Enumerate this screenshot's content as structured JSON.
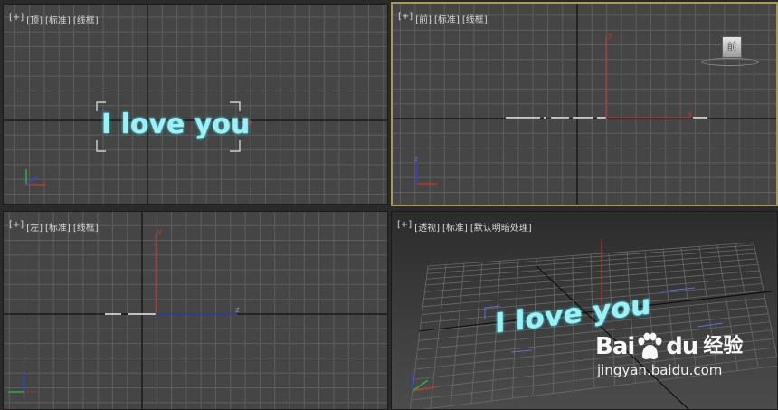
{
  "viewports": {
    "top": {
      "label": {
        "plus": "[+]",
        "view": "[顶]",
        "shading": "[标准]",
        "mode": "[线框]"
      },
      "text_object": "I love you"
    },
    "front": {
      "label": {
        "plus": "[+]",
        "view": "[前]",
        "shading": "[标准]",
        "mode": "[线框]"
      },
      "viewcube_face": "前"
    },
    "left": {
      "label": {
        "plus": "[+]",
        "view": "[左]",
        "shading": "[标准]",
        "mode": "[线框]"
      }
    },
    "perspective": {
      "label": {
        "plus": "[+]",
        "view": "[透视]",
        "shading": "[标准]",
        "mode": "[默认明暗处理]"
      },
      "text_object": "I love you"
    }
  },
  "axis_labels": {
    "x": "x",
    "y": "y",
    "z": "z"
  },
  "colors": {
    "viewport_bg": "#454545",
    "grid_line": "#5e5e5e",
    "grid_major": "#0f0f0f",
    "active_border": "#a79a55",
    "text_cyan": "#9ff0f4",
    "axis_red": "#c3342b",
    "axis_green": "#27b53a",
    "axis_blue": "#3243d2"
  },
  "watermark": {
    "logo_left": "Bai",
    "logo_right": "du",
    "logo_cn": "经验",
    "url": "jingyan.baidu.com"
  }
}
